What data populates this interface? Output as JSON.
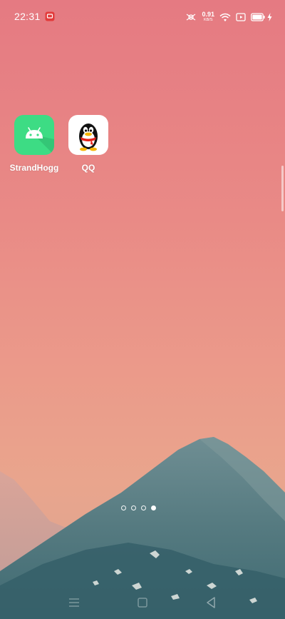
{
  "status_bar": {
    "time": "22:31",
    "network_speed_value": "0.91",
    "network_speed_unit": "KB/S",
    "icons": [
      "notification-app-icon",
      "signal-icon",
      "wifi-icon",
      "screen-record-icon",
      "battery-icon",
      "charging-icon"
    ]
  },
  "home": {
    "apps": [
      {
        "label": "StrandHogg",
        "icon": "android-icon",
        "color": "#3ddc84"
      },
      {
        "label": "QQ",
        "icon": "qq-penguin-icon",
        "color": "#ffffff"
      }
    ],
    "pages": {
      "count": 4,
      "current": 4
    }
  },
  "nav_bar": {
    "buttons": [
      "menu-icon",
      "home-icon",
      "back-icon"
    ]
  }
}
